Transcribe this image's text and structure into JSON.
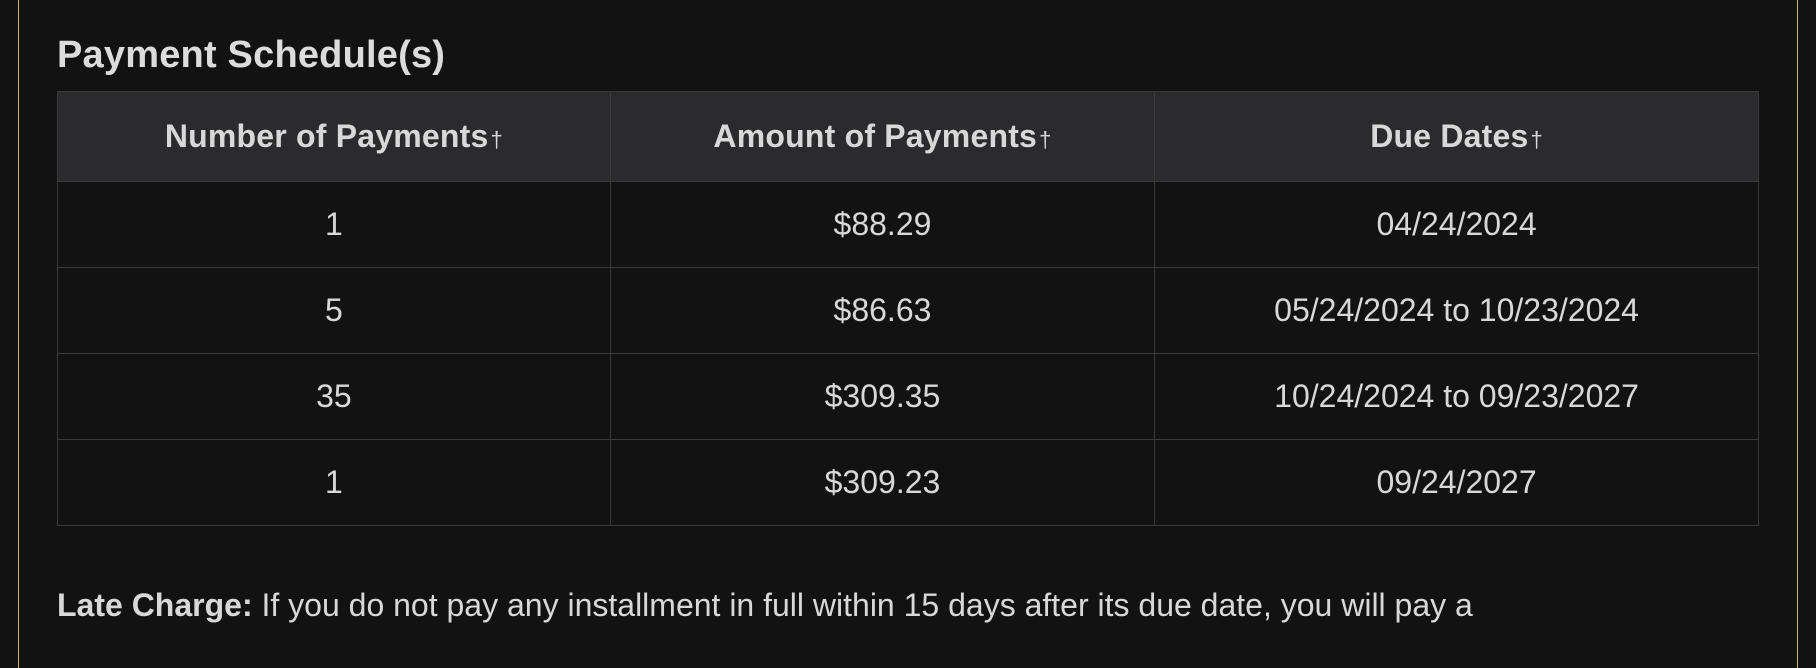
{
  "section_title": "Payment Schedule(s)",
  "dagger": "†",
  "headers": {
    "number": "Number of Payments",
    "amount": "Amount of Payments",
    "due": "Due Dates"
  },
  "rows": [
    {
      "number": "1",
      "amount": "$88.29",
      "due": "04/24/2024"
    },
    {
      "number": "5",
      "amount": "$86.63",
      "due": "05/24/2024 to 10/23/2024"
    },
    {
      "number": "35",
      "amount": "$309.35",
      "due": "10/24/2024 to 09/23/2027"
    },
    {
      "number": "1",
      "amount": "$309.23",
      "due": "09/24/2027"
    }
  ],
  "footnote": {
    "lead": "Late Charge:",
    "body": " If you do not pay any installment in full within 15 days after its due date, you will pay a"
  }
}
